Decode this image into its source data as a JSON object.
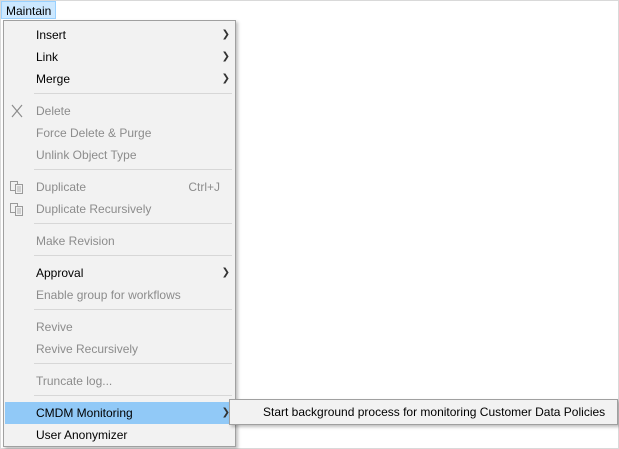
{
  "menubar": {
    "maintain_label": "Maintain"
  },
  "menu": {
    "insert": "Insert",
    "link": "Link",
    "merge": "Merge",
    "delete": "Delete",
    "force_delete": "Force Delete & Purge",
    "unlink_object_type": "Unlink Object Type",
    "duplicate": "Duplicate",
    "duplicate_shortcut": "Ctrl+J",
    "duplicate_recursively": "Duplicate Recursively",
    "make_revision": "Make Revision",
    "approval": "Approval",
    "enable_group": "Enable group for workflows",
    "revive": "Revive",
    "revive_recursively": "Revive Recursively",
    "truncate_log": "Truncate log...",
    "cmdm_monitoring": "CMDM Monitoring",
    "user_anonymizer": "User Anonymizer"
  },
  "submenu": {
    "start_background": "Start background process for monitoring Customer Data Policies"
  },
  "icons": {
    "submenu_arrow": "chevron-right-icon",
    "delete": "x-icon",
    "duplicate": "copy-icon"
  },
  "colors": {
    "menu_bg": "#f2f2f2",
    "highlight": "#91c9f7",
    "menubar_highlight": "#cce8ff",
    "disabled_text": "#8c8c8c"
  }
}
